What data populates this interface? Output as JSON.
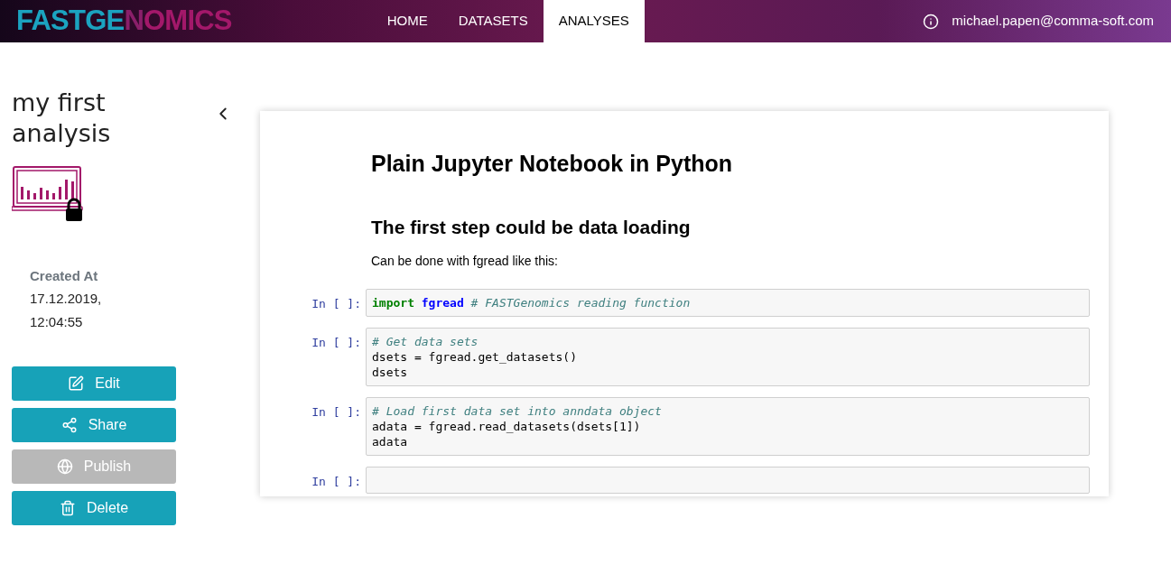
{
  "header": {
    "logo": [
      {
        "text": "FASTGE",
        "color": "#1ba3c0"
      },
      {
        "text": "N",
        "color": "#8a1f6a"
      },
      {
        "text": "OMICS",
        "color": "#a3186a"
      }
    ],
    "nav": [
      {
        "label": "HOME",
        "selected": false
      },
      {
        "label": "DATASETS",
        "selected": false
      },
      {
        "label": "ANALYSES",
        "selected": true
      }
    ],
    "user": "michael.papen@comma-soft.com"
  },
  "sidebar": {
    "title": "my first analysis",
    "created_label": "Created At",
    "created_value": "17.12.2019, 12:04:55",
    "buttons": [
      {
        "label": "Edit",
        "disabled": false
      },
      {
        "label": "Share",
        "disabled": false
      },
      {
        "label": "Publish",
        "disabled": true
      },
      {
        "label": "Delete",
        "disabled": false
      }
    ]
  },
  "notebook": {
    "title": "Plain Jupyter Notebook in Python",
    "heading": "The first step could be data loading",
    "text": "Can be done with fgread like this:",
    "cells": [
      {
        "prompt": "In [ ]:",
        "lines": [
          [
            {
              "text": "import",
              "kind": "keyword"
            },
            {
              "text": "fgread",
              "kind": "name"
            },
            {
              "text": "# FASTGenomics reading function",
              "kind": "comment"
            }
          ]
        ]
      },
      {
        "prompt": "In [ ]:",
        "lines": [
          [
            {
              "text": "# Get data sets",
              "kind": "comment"
            }
          ],
          [
            {
              "text": "dsets = fgread.get_datasets()",
              "kind": "plain"
            }
          ],
          [
            {
              "text": "dsets",
              "kind": "plain"
            }
          ]
        ]
      },
      {
        "prompt": "In [ ]:",
        "lines": [
          [
            {
              "text": "# Load first data set into anndata object",
              "kind": "comment"
            }
          ],
          [
            {
              "text": "adata = fgread.read_datasets(dsets[1])",
              "kind": "plain"
            }
          ],
          [
            {
              "text": "adata",
              "kind": "plain"
            }
          ]
        ]
      },
      {
        "prompt": "In [ ]:"
      }
    ]
  }
}
